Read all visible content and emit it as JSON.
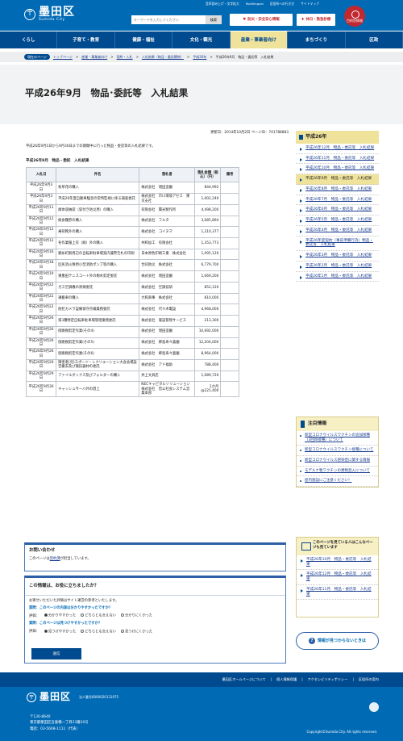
{
  "header": {
    "logo_mark": "〒",
    "logo_ja": "墨田区",
    "logo_en": "Sumida City",
    "util_links": [
      "音声読み上げ・文字拡大",
      "Multilingual",
      "区役所への行き方",
      "サイトマップ"
    ],
    "search_placeholder": "キーワードを入力してください",
    "search_button": "検索",
    "btn_disaster": "防災・安全安心情報",
    "btn_holiday": "休日・救急診療",
    "lang_button": "目的別情報"
  },
  "nav": [
    "くらし",
    "子育て・教育",
    "健康・福祉",
    "文化・観光",
    "産業・事業者向け",
    "まちづくり",
    "区政"
  ],
  "breadcrumb": {
    "current_label": "現在のページ",
    "items": [
      "トップページ",
      "産業・事業者向け",
      "契約・入札",
      "入札結果（物品・委託関係）",
      "平成26年"
    ],
    "last": "平成26年9月　物品・委託等　入札結果"
  },
  "page_title": "平成26年9月　物品･委託等　入札結果",
  "meta": "更新日：2014年10月2日 ページID：741788883",
  "intro": "平成26年9月1日から9月30日までの期間中に行った物品・委託等の入札結果です。",
  "table_caption": "平成26年9月　物品・委託　入札結果",
  "table_headers": [
    "入札日",
    "件名",
    "落札者",
    "落札金額（税込）（円）",
    "備考"
  ],
  "rows": [
    {
      "date": "平成26年9月3日",
      "name": "秋草花の購入",
      "winner": "株式会社　増田造園",
      "amount": "844,992",
      "note": ""
    },
    {
      "date": "平成26年9月3日",
      "name": "平成26年度自動車騒音の常時監視に係る調査委託",
      "winner": "株式会社　市川環境アセス　東京支社",
      "amount": "1,002,240",
      "note": ""
    },
    {
      "date": "平成26年9月11日",
      "name": "庫体収納袋（袋付き防災用）の購入",
      "winner": "有限会社　贊光製作所",
      "amount": "4,498,200",
      "note": ""
    },
    {
      "date": "平成26年9月12日",
      "name": "総食糧券の購入",
      "winner": "株式会社　フルタ",
      "amount": "3,085,894",
      "note": ""
    },
    {
      "date": "平成26年9月12日",
      "name": "乗荷靴外の購入",
      "winner": "株式会社　コイヌマ",
      "amount": "1,210,377",
      "note": ""
    },
    {
      "date": "平成26年9月12日",
      "name": "冬作業服上衣（緑）外の購入",
      "winner": "共和加工　有限会社",
      "amount": "1,353,773",
      "note": ""
    },
    {
      "date": "平成26年9月16日",
      "name": "錦糸町駅周辺の自転車駐車場案内兼警告札の印刷",
      "winner": "日本原色印刷工業　株式会社",
      "amount": "1,095,120",
      "note": ""
    },
    {
      "date": "平成26年9月18日",
      "name": "区民消火隊用小型消防ポンプ等の購入",
      "winner": "合同防災　株式会社",
      "amount": "6,779,700",
      "note": ""
    },
    {
      "date": "平成26年9月19日",
      "name": "東墨田テニスコート外の樹木剪定委託",
      "winner": "株式会社　増田造園",
      "amount": "1,069,200",
      "note": ""
    },
    {
      "date": "平成26年9月22日",
      "name": "ガス空調機の清掃委託",
      "winner": "株式会社　空調技研",
      "amount": "852,120",
      "note": ""
    },
    {
      "date": "平成26年9月22日",
      "name": "運搬車の購入",
      "winner": "大和商事　株式会社",
      "amount": "810,000",
      "note": ""
    },
    {
      "date": "平成26年9月22日",
      "name": "防犯カメラ設備保守点検業務委託",
      "winner": "株式会社　代々木電設",
      "amount": "4,968,000",
      "note": ""
    },
    {
      "date": "平成26年9月26日",
      "name": "第3種特定自転車駐車場管理業務委託",
      "winner": "株式会社　施設管理サービス",
      "amount": "213,300",
      "note": ""
    },
    {
      "date": "平成26年9月26日",
      "name": "街路樹剪定作業(その4)",
      "winner": "株式会社　増田造園",
      "amount": "10,692,000",
      "note": ""
    },
    {
      "date": "平成26年9月26日",
      "name": "街路樹剪定作業(その5)",
      "winner": "株式会社　柳島寿々喜園",
      "amount": "12,204,000",
      "note": ""
    },
    {
      "date": "平成26年9月26日",
      "name": "街路樹剪定作業(その6)",
      "winner": "株式会社　柳島寿々喜園",
      "amount": "8,964,000",
      "note": ""
    },
    {
      "date": "平成26年9月29日",
      "name": "障害者(児)スポーツ・レクリエーション大会会場設営撤去及び競技器材の委託",
      "winner": "株式会社　アド福助",
      "amount": "788,400",
      "note": ""
    },
    {
      "date": "平成26年9月29日",
      "name": "ファイルボックス及びフォルダーの購入",
      "winner": "井上文具店",
      "amount": "1,089,720",
      "note": ""
    },
    {
      "date": "平成26年9月30日",
      "name": "キャッシュサーバ外の借上",
      "winner": "NECキャピタルソリューション　株式会社　官公社会システム営業本部",
      "amount": "1か月@221,400",
      "note": ""
    }
  ],
  "contact": {
    "title": "お問い合わせ",
    "text_pre": "このページは",
    "link": "契約課",
    "text_post": "が担当しています。"
  },
  "survey": {
    "title": "この情報は、お役に立ちましたか？",
    "lead": "お寄せいただいた評価はサイト運営の参考といたします。",
    "q1": "質問：このページの内容は分かりやすかったですか？",
    "q1_label": "評価：",
    "q1_opts": [
      "分かりやすかった",
      "どちらとも言えない",
      "分かりにくかった"
    ],
    "q2": "質問：このページは見つけやすかったですか？",
    "q2_label": "評価：",
    "q2_opts": [
      "見つけやすかった",
      "どちらとも言えない",
      "見つけにくかった"
    ],
    "submit": "送信"
  },
  "sidebar": {
    "heading": "平成26年",
    "items": [
      "平成26年12月　物品・委託等　入札結果",
      "平成26年11月　物品・委託等　入札結果",
      "平成26年10月　物品・委託等　入札結果",
      "平成26年9月　物品・委託等　入札結果",
      "平成26年8月　物品・委託等　入札結果",
      "平成26年7月　物品・委託等　入札結果",
      "平成26年6月　物品・委託等　入札結果",
      "平成26年5月　物品・委託等　入札結果",
      "平成26年4月　物品・委託等　入札結果",
      "平成26年度契約（事前準備行為）物品・委託等　入札結果",
      "平成26年3月　物品・委託等　入札結果",
      "平成26年2月　物品・委託等　入札結果",
      "平成26年1月　物品・委託等　入札結果"
    ],
    "selected_index": 3
  },
  "attention": {
    "heading": "注目情報",
    "items": [
      "新型コロナウイルスワクチンの追加接種（3回目接種）について",
      "新型コロナウイルスワクチン接種について",
      "新型コロナウイルス感染症に関する情報",
      "モデルナ製ワクチンの異物混入について",
      "屋内施設にご注意ください！"
    ]
  },
  "seen": {
    "heading": "このページを見ている人はこんなページも見ています",
    "items": [
      "平成26年10月　物品・委託等　入札結果",
      "平成26年12月　物品・委託等　入札結果",
      "平成26年11月　物品・委託等　入札結果"
    ]
  },
  "notfound": "情報が見つからないときは",
  "footer": {
    "links": [
      "墨田区ホームページについて",
      "個人情報保護",
      "アクセシビリティポリシー",
      "区役所の案内"
    ],
    "logo_mark": "〒",
    "logo_ja": "墨田区",
    "corp_no": "法人番号6000020131075",
    "postal": "〒130-8640",
    "address": "東京都墨田区吾妻橋一丁目23番20号",
    "phone": "電話：03-5608-1111（代表）",
    "copyright": "Copyright©Sumida City. All rights reserved."
  },
  "colors": {
    "primary": "#006ab5",
    "dark": "#004a8f",
    "accent_red": "#c2282f",
    "highlight": "#efe29a"
  }
}
